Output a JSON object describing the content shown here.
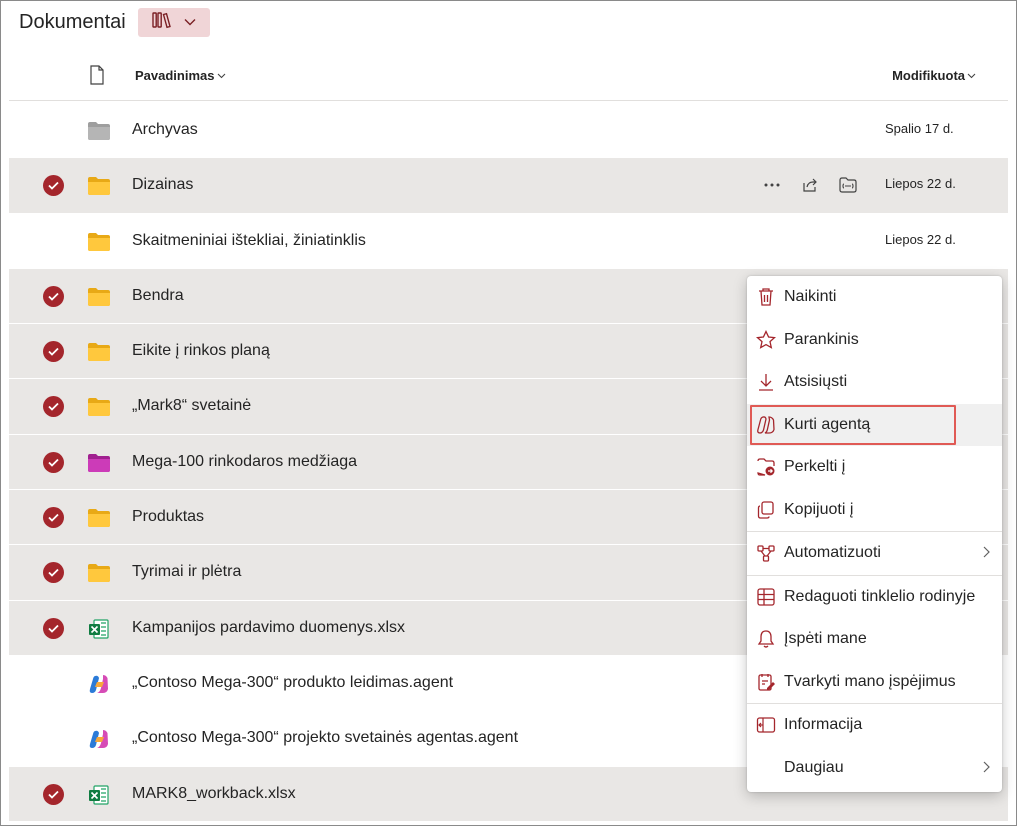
{
  "header": {
    "title": "Dokumentai"
  },
  "columns": {
    "name": "Pavadinimas",
    "modified": "Modifikuota"
  },
  "rows": [
    {
      "name": "Archyvas",
      "modified": "Spalio 17 d.",
      "selected": false,
      "icon": "folder-gray"
    },
    {
      "name": "Dizainas",
      "modified": "Liepos 22 d.",
      "selected": true,
      "icon": "folder-yellow"
    },
    {
      "name": "Skaitmeniniai ištekliai, žiniatinklis",
      "modified": "Liepos 22 d.",
      "selected": false,
      "icon": "folder-yellow"
    },
    {
      "name": "Bendra",
      "modified": "",
      "selected": true,
      "icon": "folder-yellow"
    },
    {
      "name": "Eikite į rinkos planą",
      "modified": "",
      "selected": true,
      "icon": "folder-yellow"
    },
    {
      "name": "„Mark8“ svetainė",
      "modified": "",
      "selected": true,
      "icon": "folder-yellow"
    },
    {
      "name": "Mega-100 rinkodaros medžiaga",
      "modified": "",
      "selected": true,
      "icon": "folder-magenta"
    },
    {
      "name": "Produktas",
      "modified": "",
      "selected": true,
      "icon": "folder-yellow"
    },
    {
      "name": "Tyrimai ir plėtra",
      "modified": "",
      "selected": true,
      "icon": "folder-yellow"
    },
    {
      "name": "Kampanijos pardavimo duomenys.xlsx",
      "modified": "",
      "selected": true,
      "icon": "excel-icon"
    },
    {
      "name": "„Contoso Mega-300“ produkto leidimas.agent",
      "modified": "",
      "selected": false,
      "icon": "copilot-icon"
    },
    {
      "name": "„Contoso Mega-300“ projekto svetainės agentas.agent",
      "modified": "",
      "selected": false,
      "icon": "copilot-icon"
    },
    {
      "name": "MARK8_workback.xlsx",
      "modified": "",
      "selected": true,
      "icon": "excel-icon"
    }
  ],
  "menu": {
    "items": [
      {
        "label": "Naikinti",
        "icon": "trash-icon"
      },
      {
        "label": "Parankinis",
        "icon": "star-icon"
      },
      {
        "label": "Atsisiųsti",
        "icon": "download-icon"
      },
      {
        "label": "Kurti agentą",
        "icon": "copilot-agent-icon",
        "highlighted": true
      },
      {
        "label": "Perkelti į",
        "icon": "move-icon"
      },
      {
        "label": "Kopijuoti į",
        "icon": "copy-icon"
      },
      {
        "label": "Automatizuoti",
        "icon": "automate-icon",
        "submenu": true
      },
      {
        "label": "Redaguoti tinklelio rodinyje",
        "icon": "grid-icon"
      },
      {
        "label": "Įspėti mane",
        "icon": "bell-icon"
      },
      {
        "label": "Tvarkyti mano įspėjimus",
        "icon": "manage-alerts-icon"
      },
      {
        "label": "Informacija",
        "icon": "info-icon"
      },
      {
        "label": "Daugiau",
        "icon": "",
        "submenu": true
      }
    ]
  },
  "colors": {
    "accent": "#a4262c",
    "selected_row": "#e9e7e5",
    "highlight_outline": "#e05a55"
  }
}
